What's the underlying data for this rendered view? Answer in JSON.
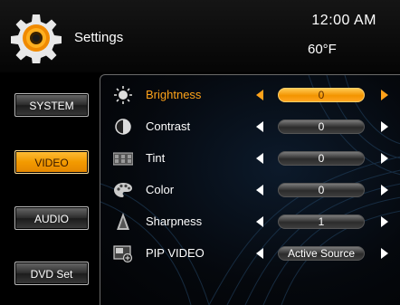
{
  "header": {
    "title": "Settings",
    "time": "12:00 AM",
    "temperature": "60°F",
    "icon": "settings-gear-icon"
  },
  "sidebar": {
    "items": [
      {
        "label": "SYSTEM",
        "active": false
      },
      {
        "label": "VIDEO",
        "active": true
      },
      {
        "label": "AUDIO",
        "active": false
      },
      {
        "label": "DVD Set",
        "active": false
      }
    ]
  },
  "settings": [
    {
      "label": "Brightness",
      "value": "0",
      "icon": "brightness-icon",
      "selected": true
    },
    {
      "label": "Contrast",
      "value": "0",
      "icon": "contrast-icon",
      "selected": false
    },
    {
      "label": "Tint",
      "value": "0",
      "icon": "tint-icon",
      "selected": false
    },
    {
      "label": "Color",
      "value": "0",
      "icon": "color-palette-icon",
      "selected": false
    },
    {
      "label": "Sharpness",
      "value": "1",
      "icon": "sharpness-icon",
      "selected": false
    },
    {
      "label": "PIP VIDEO",
      "value": "Active Source",
      "icon": "pip-video-icon",
      "selected": false
    }
  ],
  "colors": {
    "accent": "#ffa21a",
    "background": "#000000",
    "panel": "#0c1a2b"
  }
}
